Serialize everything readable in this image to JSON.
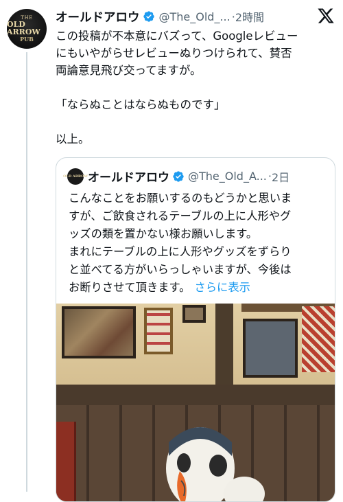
{
  "tweet": {
    "avatar_text": [
      "THE",
      "OLD ARROW",
      "PUB"
    ],
    "display_name": "オールドアロウ",
    "handle": "@The_Old_...",
    "separator": "·",
    "time": "2時間",
    "text_lines": [
      "この投稿が不本意にバズって、Googleレビュー",
      "にもいやがらせレビューぬりつけられて、賛否",
      "両論意見飛び交ってますが。",
      "",
      "「ならぬことはならぬものです」",
      "",
      "以上。"
    ]
  },
  "quoted_tweet": {
    "display_name": "オールドアロウ",
    "handle": "@The_Old_A...",
    "separator": "·",
    "time": "2日",
    "text_lines": [
      "こんなことをお願いするのもどうかと思いま",
      "すが、ご飲食されるテーブルの上に人形やグ",
      "ッズの類を置かない様お願いします。",
      "まれにテーブルの上に人形やグッズをずらり",
      "と並べてる方がいらっしゃいますが、今後は"
    ],
    "last_line": "お断りさせて頂きます。",
    "show_more_label": "さらに表示"
  },
  "icons": {
    "close": "x-logo-icon",
    "verified": "verified-badge-icon"
  },
  "colors": {
    "accent": "#1d9bf0",
    "secondary_text": "#536471",
    "border": "#cfd9de"
  }
}
